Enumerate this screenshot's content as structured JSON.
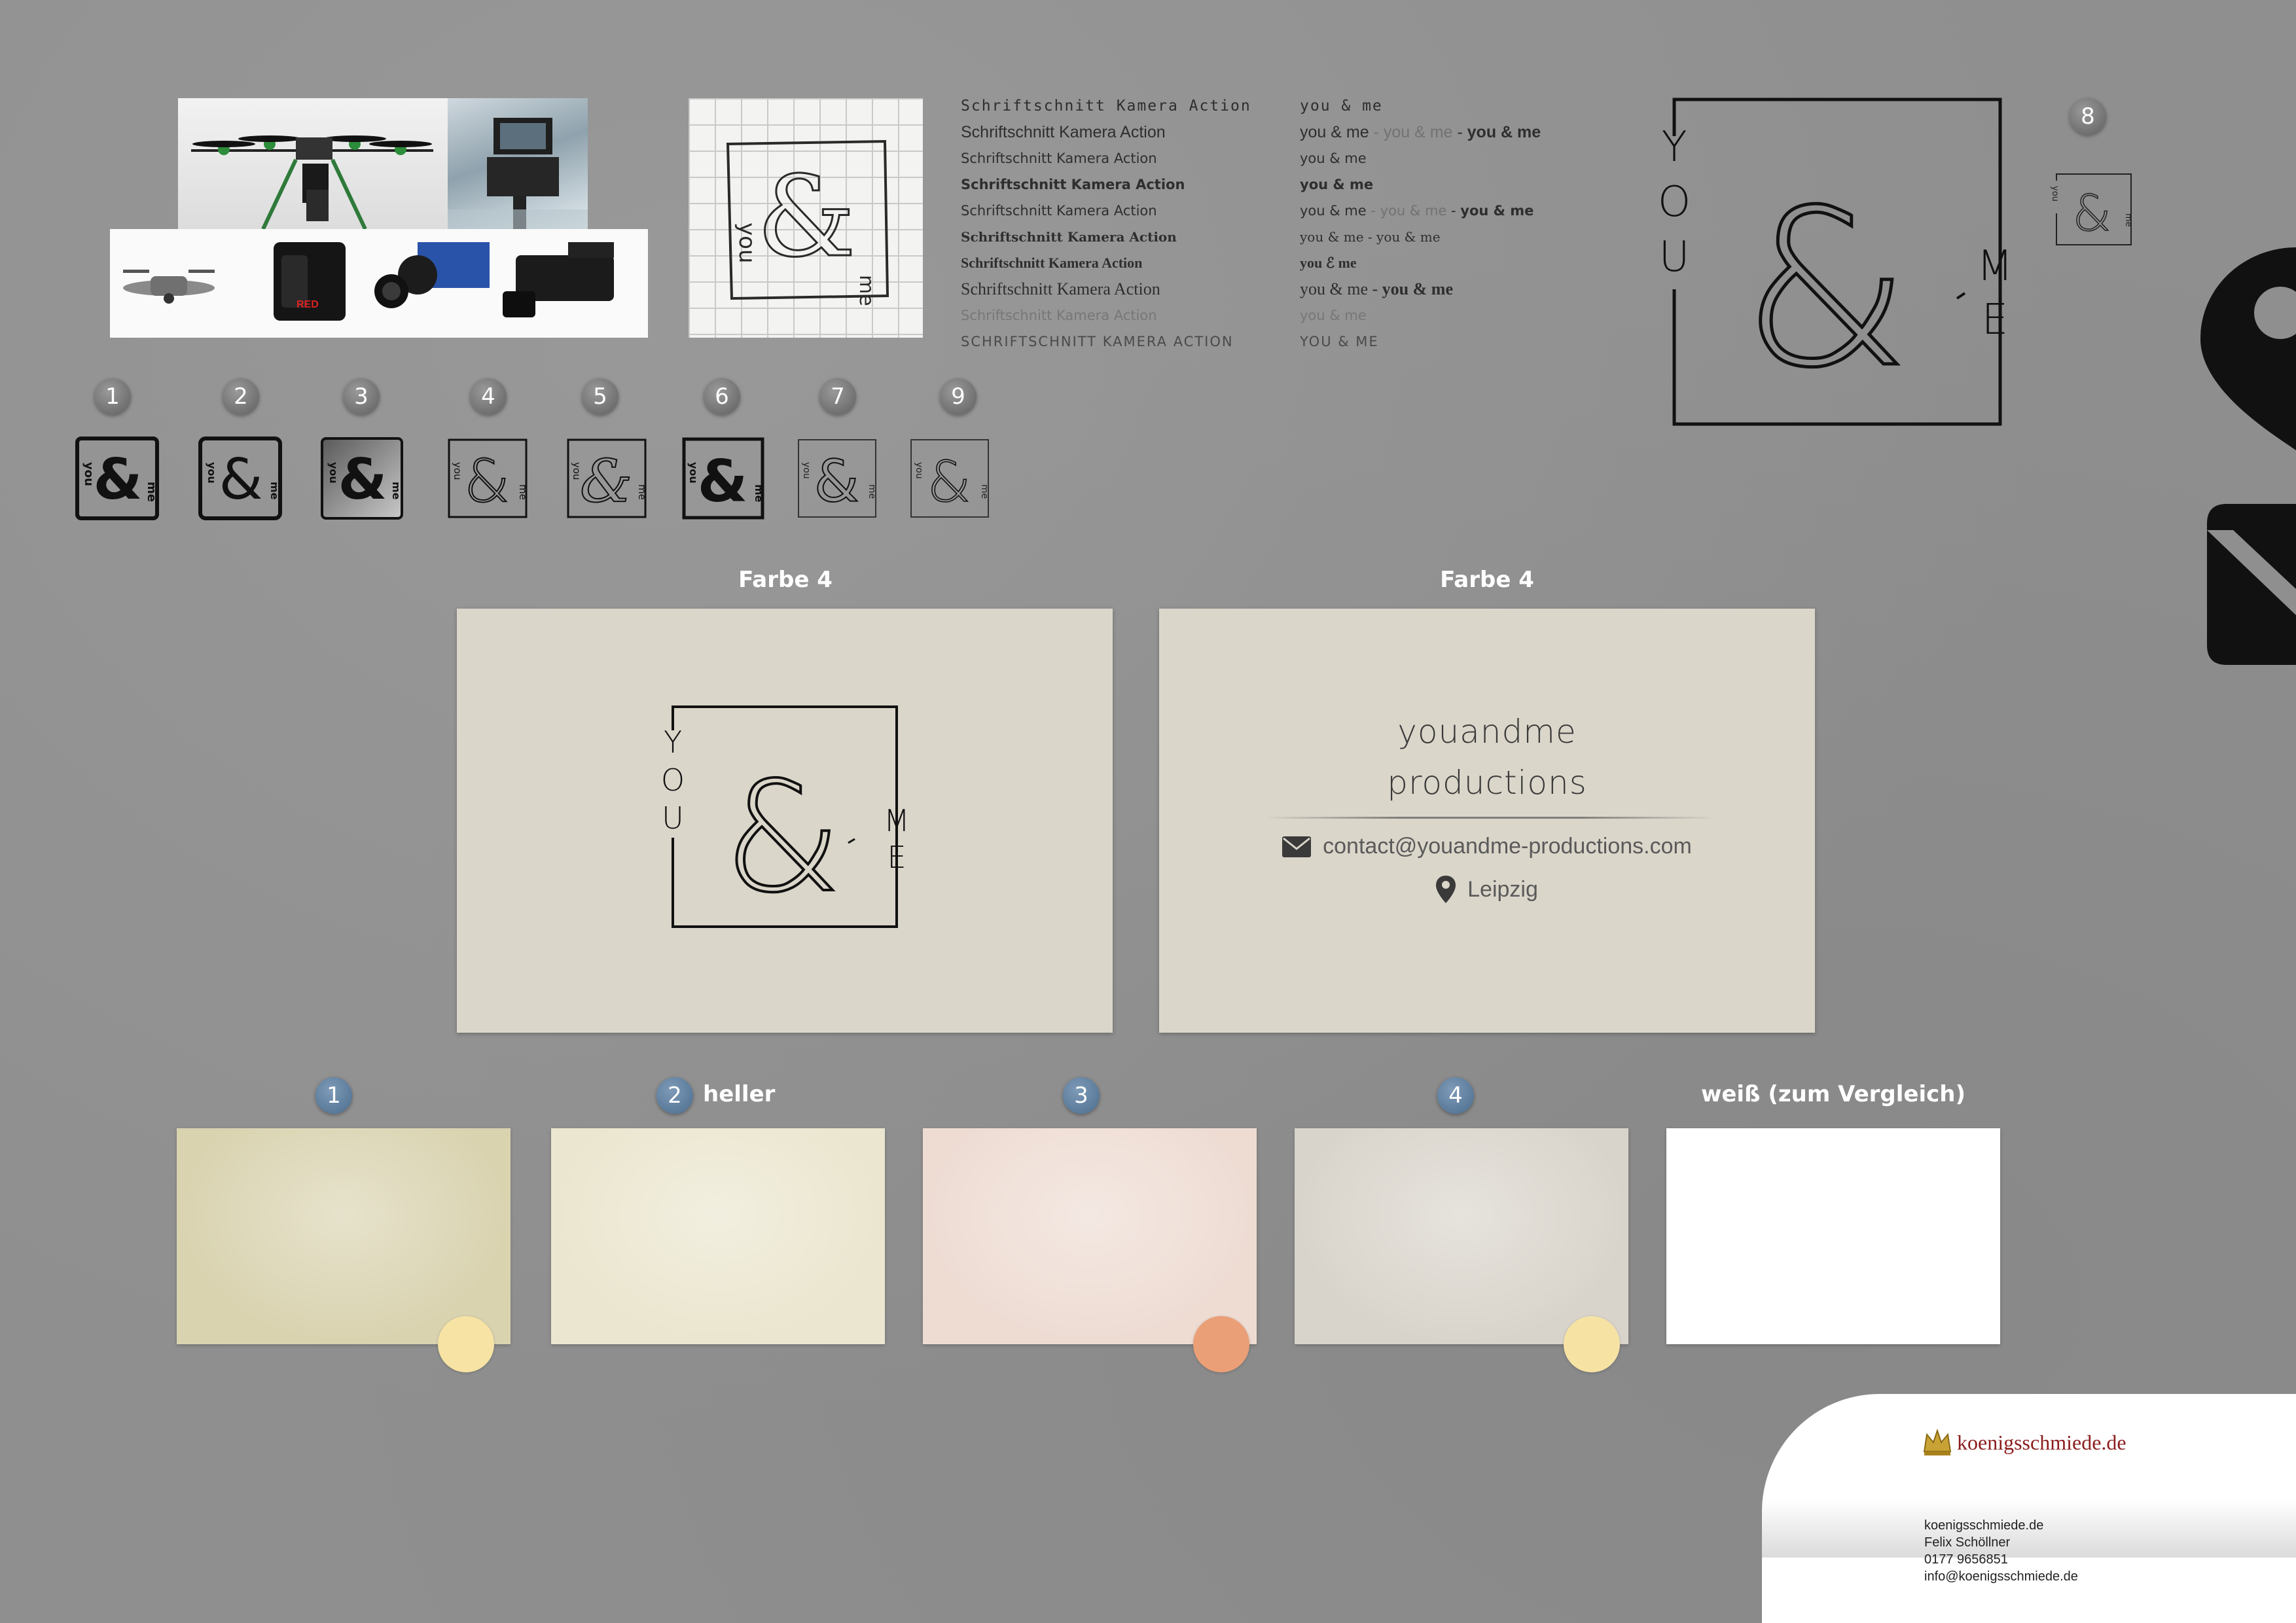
{
  "typography": {
    "left": [
      "Schriftschnitt Kamera Action",
      "Schriftschnitt Kamera Action",
      "Schriftschnitt Kamera Action",
      "Schriftschnitt Kamera Action",
      "Schriftschnitt Kamera Action",
      "Schriftschnitt Kamera Action",
      "Schriftschnitt Kamera Action",
      "Schriftschnitt Kamera Action",
      "Schriftschnitt Kamera Action",
      "SCHRIFTSCHNITT KAMERA ACTION"
    ],
    "right": [
      "you & me",
      "you & me",
      "you & me",
      "you & me",
      "you & me",
      "you & me",
      "you ℰ me",
      "you & me",
      "you & me",
      "YOU & ME"
    ],
    "right_extra": {
      "line2_mid": "you & me",
      "line2_end": "you & me",
      "line5_mid": "you & me",
      "line5_end": "you & me",
      "line6_end": "you & me",
      "line8_end": "you & me",
      "sep": " - "
    }
  },
  "badges": {
    "variants": [
      "1",
      "2",
      "3",
      "4",
      "5",
      "6",
      "7",
      "9"
    ],
    "main": "8",
    "swatches": [
      "1",
      "2",
      "3",
      "4"
    ]
  },
  "logo": {
    "ampersand": "&",
    "you_letters": [
      "Y",
      "O",
      "U"
    ],
    "me_letters": [
      "M",
      "E"
    ],
    "you_lower": "you",
    "me_lower": "me"
  },
  "cards": {
    "front_label": "Farbe 4",
    "back_label": "Farbe 4",
    "name_line1": "youandme",
    "name_line2": "productions",
    "email": "contact@youandme-productions.com",
    "location": "Leipzig",
    "color": "#dbd6ca"
  },
  "swatches": {
    "label_2_suffix": "heller",
    "label_white": "weiß (zum Vergleich)",
    "colors": [
      "#d9d3b0",
      "#ebe6cf",
      "#eedcd3",
      "#d9d4cb",
      "#ffffff"
    ],
    "dots": [
      "#f7e3a3",
      "#f6ebb7",
      "#eb9f77",
      "#f6e3a4"
    ]
  },
  "reference_photos": {
    "camera_brand": "RED"
  },
  "footer": {
    "logo_text": "koenigsschmiede.de",
    "lines": [
      "koenigsschmiede.de",
      "Felix Schöllner",
      "0177 9656851",
      "info@koenigsschmiede.de"
    ]
  }
}
